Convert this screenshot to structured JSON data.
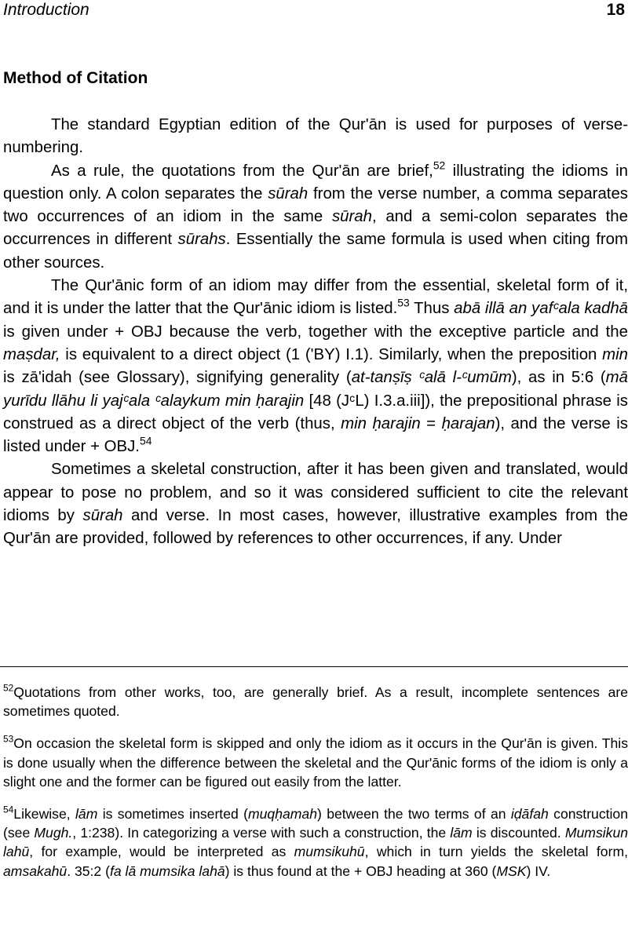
{
  "running_head": {
    "title": "Introduction",
    "page_number": "18"
  },
  "section": {
    "heading": "Method of Citation"
  },
  "body": {
    "p1": "The standard Egyptian edition of the Qur'ān is used for purposes of verse-numbering.",
    "p2": {
      "a": "As a rule, the quotations from the Qur'ān are brief,",
      "fn": "52",
      "b": " illustrating the idioms in question only.  A colon separates the ",
      "c": "sūrah",
      "d": " from the verse number, a comma separates two occurrences of an idiom in the same ",
      "e": "sūrah",
      "f": ", and a semi-colon separates the occurrences in different ",
      "g": "sūrahs",
      "h": ".  Essentially the same formula is used when citing from other sources."
    },
    "p3": {
      "a": "The Qur'ānic form of an idiom may differ from the essential, skeletal form of it, and it is under the latter that the Qur'ānic idiom is listed.",
      "fn": "53",
      "b": "  Thus ",
      "c": "abā illā an yafᶜala kadhā",
      "d": " is given under + OBJ because the verb, together with the exceptive particle and the ",
      "e": "maṣdar,",
      "f": " is equivalent to a direct object (1 ('BY) I.1).  Similarly, when the preposition ",
      "g": "min",
      "h": " is ",
      "i": "zā'idah",
      "j": " (see Glossary), signifying generality (",
      "k": "at-tanṣīṣ ᶜalā l-ᶜumūm",
      "l": "), as in 5:6 (",
      "m": "mā yurīdu llāhu li yajᶜala ᶜalaykum min ḥarajin",
      "n": " [48 (JᶜL) I.3.a.iii]), the prepositional phrase is construed as a direct object of the verb (thus, ",
      "o": "min ḥarajin",
      "p": " = ",
      "q": "ḥarajan",
      "r": "), and the verse is listed under + OBJ.",
      "fn2": "54"
    },
    "p4": {
      "a": "Sometimes a skeletal construction, after it has been given and translated, would appear to pose no problem, and so it was considered sufficient to cite the relevant idioms by ",
      "b": "sūrah",
      "c": " and verse.  In most cases, however, illustrative examples from the Qur'ān are provided, followed by references to other occurrences, if any.  Under"
    }
  },
  "footnotes": {
    "fn52": {
      "num": "52",
      "text": "Quotations from other works, too, are generally brief.  As a result, incomplete sentences are sometimes quoted."
    },
    "fn53": {
      "num": "53",
      "text": "On occasion the skeletal form is skipped and only the idiom as it occurs in the Qur'ān is given.  This is done usually when the difference between the skeletal and the Qur'ānic forms of the idiom is only a slight one and the former can be figured out easily from the latter."
    },
    "fn54": {
      "num": "54",
      "a": "Likewise, ",
      "b": "lām",
      "c": " is sometimes inserted (",
      "d": "muqḥamah",
      "e": ") between the two terms of an ",
      "f": "iḍāfah",
      "g": " construction (see ",
      "h": "Mugh.",
      "i": ", 1:238).  In categorizing a verse with such a construction, the ",
      "j": "lām",
      "k": " is discounted.  ",
      "l": "Mumsikun lahū",
      "m": ", for example, would be interpreted as ",
      "n": "mumsikuhū",
      "o": ", which in turn yields the skeletal form, ",
      "p": "amsakahū",
      "q": ".  35:2 (",
      "r": "fa lā mumsika lahā",
      "s": ") is thus found at the + OBJ heading at 360 (",
      "t": "MSK",
      "u": ") IV."
    }
  }
}
